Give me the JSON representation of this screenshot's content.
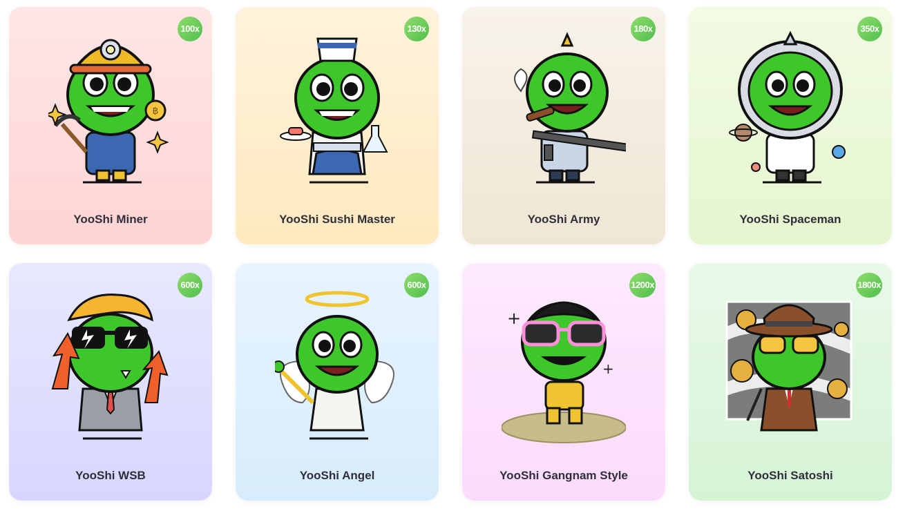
{
  "cards": [
    {
      "name": "YooShi Miner",
      "multiplier": "100x",
      "accessory": "miner-helmet-icon"
    },
    {
      "name": "YooShi Sushi Master",
      "multiplier": "130x",
      "accessory": "sushi-chef-hat-icon"
    },
    {
      "name": "YooShi Army",
      "multiplier": "180x",
      "accessory": "rifle-icon"
    },
    {
      "name": "YooShi Spaceman",
      "multiplier": "350x",
      "accessory": "space-helmet-icon"
    },
    {
      "name": "YooShi WSB",
      "multiplier": "600x",
      "accessory": "sunglasses-icon"
    },
    {
      "name": "YooShi Angel",
      "multiplier": "600x",
      "accessory": "halo-icon"
    },
    {
      "name": "YooShi Gangnam Style",
      "multiplier": "1200x",
      "accessory": "pink-glasses-icon"
    },
    {
      "name": "YooShi Satoshi",
      "multiplier": "1800x",
      "accessory": "fedora-icon"
    }
  ],
  "colors": {
    "yooshi_green": "#3ec72b",
    "badge_green": "#5cc655",
    "title_text": "#2f2f3a"
  }
}
